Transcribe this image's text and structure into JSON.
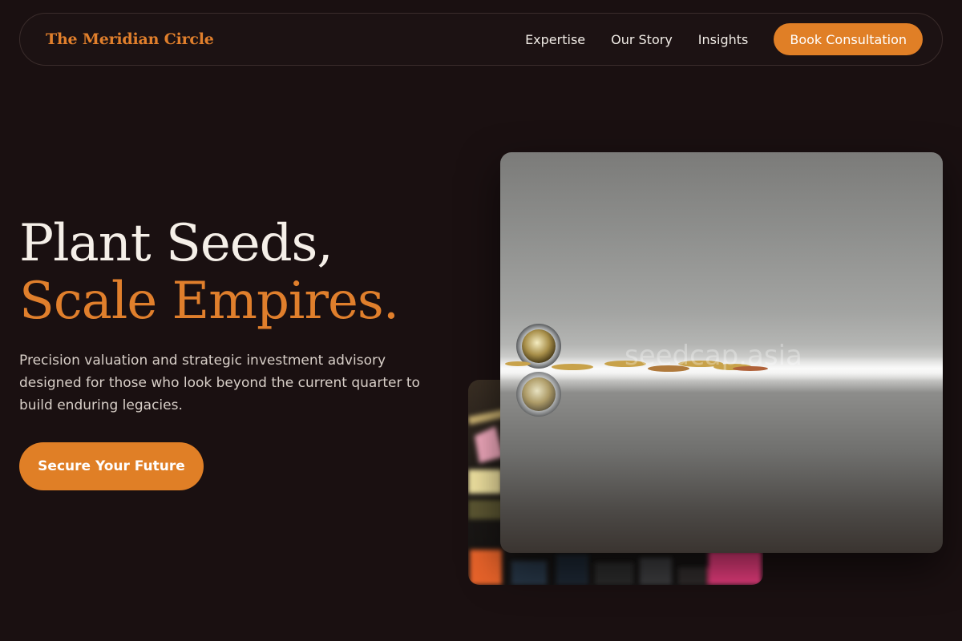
{
  "brand": {
    "name": "The Meridian Circle"
  },
  "nav": {
    "links": [
      "Expertise",
      "Our Story",
      "Insights"
    ],
    "cta": "Book Consultation"
  },
  "hero": {
    "headline_line1": "Plant Seeds,",
    "headline_line2": "Scale Empires.",
    "lede": "Precision valuation and strategic investment advisory designed for those who look beyond the current quarter to build enduring legacies.",
    "cta": "Secure Your Future"
  },
  "images": {
    "front_watermark": "seedcap.asia",
    "front_icon": "coins-photo",
    "back_icon": "planning-blocks-photo"
  },
  "colors": {
    "background": "#1a1011",
    "accent": "#e07f26",
    "text": "#f3ede6"
  }
}
